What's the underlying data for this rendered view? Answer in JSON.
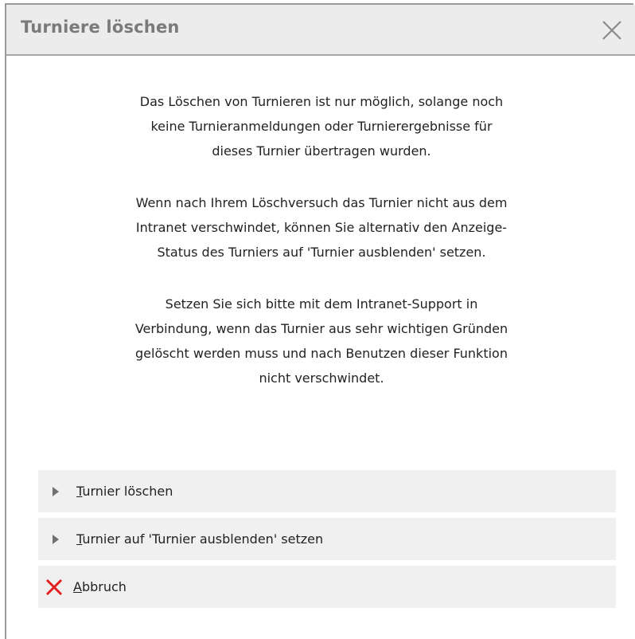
{
  "dialog": {
    "title": "Turniere löschen",
    "close_icon": "close-icon"
  },
  "message": {
    "paragraph1": [
      "Das Löschen von Turnieren ist nur möglich, solange noch",
      "keine Turnieranmeldungen oder Turnierergebnisse für",
      "dieses Turnier übertragen wurden."
    ],
    "paragraph2": [
      "Wenn nach Ihrem Löschversuch das Turnier nicht aus dem",
      "Intranet verschwindet, können Sie alternativ den Anzeige-",
      "Status des Turniers auf 'Turnier ausblenden' setzen."
    ],
    "paragraph3": [
      "Setzen Sie sich bitte mit dem Intranet-Support in",
      "Verbindung, wenn das Turnier aus sehr wichtigen Gründen",
      "gelöscht werden muss und nach Benutzen dieser Funktion",
      "nicht verschwindet."
    ]
  },
  "options": {
    "delete": {
      "accesskey": "T",
      "label_rest": "urnier löschen",
      "icon": "triangle-right-icon"
    },
    "hide": {
      "accesskey": "T",
      "label_rest": "urnier auf 'Turnier ausblenden' setzen",
      "icon": "triangle-right-icon"
    },
    "cancel": {
      "accesskey": "A",
      "label_rest": "bbruch",
      "icon": "red-x-icon",
      "icon_color": "#e02020"
    }
  }
}
